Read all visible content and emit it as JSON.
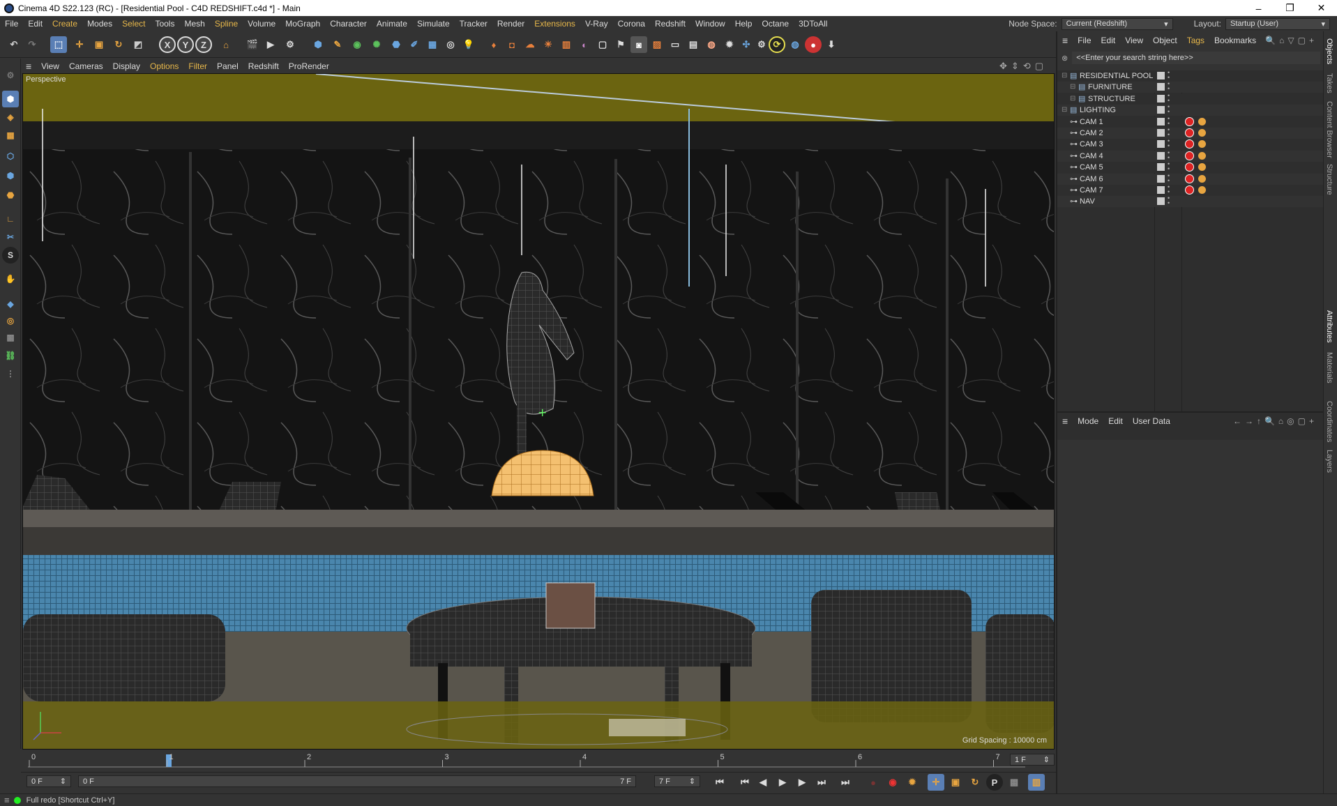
{
  "window": {
    "title": "Cinema 4D S22.123 (RC) - [Residential Pool - C4D REDSHIFT.c4d *] - Main",
    "minimize": "–",
    "maximize": "❐",
    "close": "✕"
  },
  "menubar": {
    "items": [
      "File",
      "Edit",
      "Create",
      "Modes",
      "Select",
      "Tools",
      "Mesh",
      "Spline",
      "Volume",
      "MoGraph",
      "Character",
      "Animate",
      "Simulate",
      "Tracker",
      "Render",
      "Extensions",
      "V-Ray",
      "Corona",
      "Redshift",
      "Window",
      "Help",
      "Octane",
      "3DToAll"
    ],
    "highlighted": [
      "Create",
      "Select",
      "Spline",
      "Extensions"
    ],
    "node_space_label": "Node Space:",
    "node_space_value": "Current (Redshift)",
    "layout_label": "Layout:",
    "layout_value": "Startup (User)"
  },
  "toolbar": {
    "axis_x": "X",
    "axis_y": "Y",
    "axis_z": "Z"
  },
  "viewport_menu": {
    "items": [
      "View",
      "Cameras",
      "Display",
      "Options",
      "Filter",
      "Panel",
      "Redshift",
      "ProRender"
    ],
    "highlighted": [
      "Options",
      "Filter"
    ],
    "label": "Perspective",
    "grid_spacing": "Grid Spacing : 10000 cm"
  },
  "timeline": {
    "ticks": [
      "0",
      "1",
      "2",
      "3",
      "4",
      "5",
      "6",
      "7"
    ],
    "current_frame": 1,
    "end_field": "1 F"
  },
  "transport": {
    "start_field": "0 F",
    "range_start": "0 F",
    "range_end": "7 F",
    "end_field": "7 F"
  },
  "status": {
    "text": "Full redo [Shortcut Ctrl+Y]"
  },
  "object_manager": {
    "menu": [
      "File",
      "Edit",
      "View",
      "Object",
      "Tags",
      "Bookmarks"
    ],
    "highlighted": [
      "Tags"
    ],
    "search_placeholder": "<<Enter your search string here>>",
    "objects": [
      {
        "name": "RESIDENTIAL POOL",
        "indent": 0,
        "type": "layer",
        "tags": false
      },
      {
        "name": "FURNITURE",
        "indent": 1,
        "type": "layer",
        "tags": false
      },
      {
        "name": "STRUCTURE",
        "indent": 1,
        "type": "layer",
        "tags": false
      },
      {
        "name": "LIGHTING",
        "indent": 0,
        "type": "layer",
        "tags": false
      },
      {
        "name": "CAM 1",
        "indent": 0,
        "type": "camera",
        "tags": true
      },
      {
        "name": "CAM 2",
        "indent": 0,
        "type": "camera",
        "tags": true
      },
      {
        "name": "CAM 3",
        "indent": 0,
        "type": "camera",
        "tags": true
      },
      {
        "name": "CAM 4",
        "indent": 0,
        "type": "camera",
        "tags": true
      },
      {
        "name": "CAM 5",
        "indent": 0,
        "type": "camera",
        "tags": true
      },
      {
        "name": "CAM 6",
        "indent": 0,
        "type": "camera",
        "tags": true
      },
      {
        "name": "CAM 7",
        "indent": 0,
        "type": "camera",
        "tags": true
      },
      {
        "name": "NAV",
        "indent": 0,
        "type": "camera",
        "tags": false
      }
    ]
  },
  "attribute_manager": {
    "menu": [
      "Mode",
      "Edit",
      "User Data"
    ]
  },
  "side_tabs": [
    "Objects",
    "Takes",
    "Content Browser",
    "Structure",
    "Attributes",
    "Materials",
    "Coordinates",
    "Layers"
  ]
}
